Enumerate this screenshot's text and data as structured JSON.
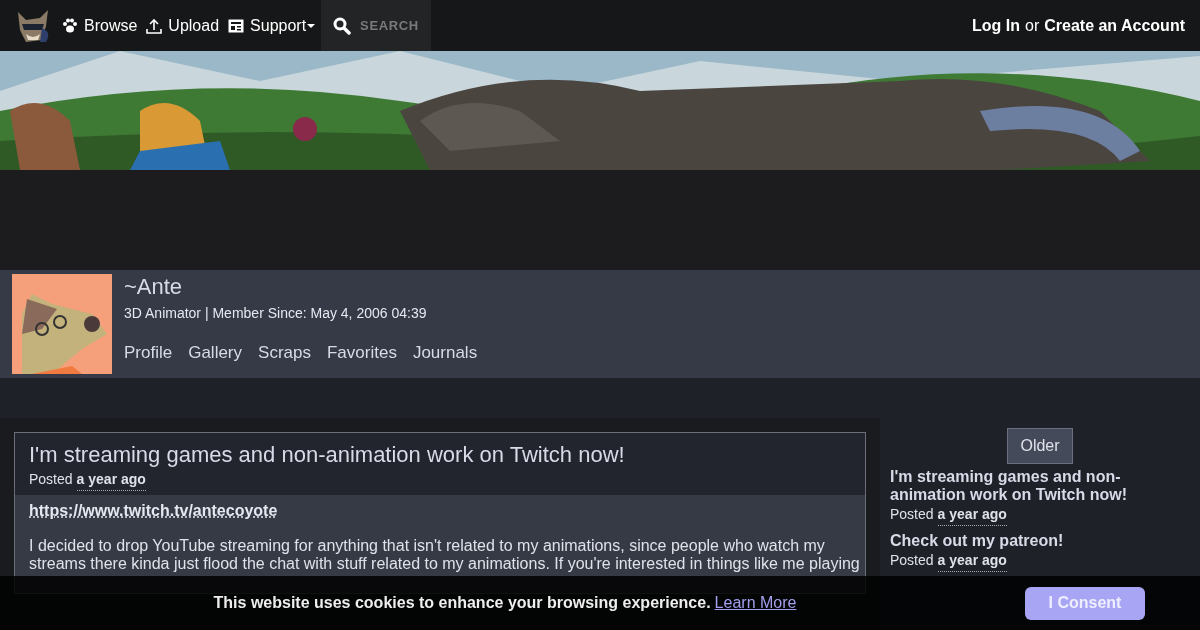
{
  "nav": {
    "items": [
      {
        "label": "Browse",
        "kind": "paw"
      },
      {
        "label": "Upload",
        "kind": "upload"
      },
      {
        "label": "Support",
        "kind": "support"
      }
    ],
    "search": {
      "placeholder": "SEARCH"
    },
    "login": "Log In",
    "or": "or",
    "create": "Create an Account"
  },
  "profile": {
    "name": "~Ante",
    "subtitle": "3D Animator | Member Since: May 4, 2006 04:39",
    "tabs": [
      {
        "label": "Profile"
      },
      {
        "label": "Gallery"
      },
      {
        "label": "Scraps"
      },
      {
        "label": "Favorites"
      },
      {
        "label": "Journals"
      }
    ]
  },
  "journal": {
    "title": "I'm streaming games and non-animation work on Twitch now!",
    "posted": "Posted",
    "time": "a year ago",
    "link": "https://www.twitch.tv/antecoyote",
    "body": "I decided to drop YouTube streaming for anything that isn't related to my animations, since people who watch my streams there kinda just flood the chat with stuff related to my animations. If you're interested in things like me playing"
  },
  "sidebar": {
    "older": "Older",
    "entries": [
      {
        "title": "I'm streaming games and non-animation work on Twitch now!",
        "posted": "Posted",
        "time": "a year ago"
      },
      {
        "title": "Check out my patreon!",
        "posted": "Posted",
        "time": "a year ago"
      }
    ]
  },
  "cookie": {
    "text": "This website uses cookies to enhance your browsing experience.",
    "link": "Learn More",
    "button": "I Consent"
  }
}
